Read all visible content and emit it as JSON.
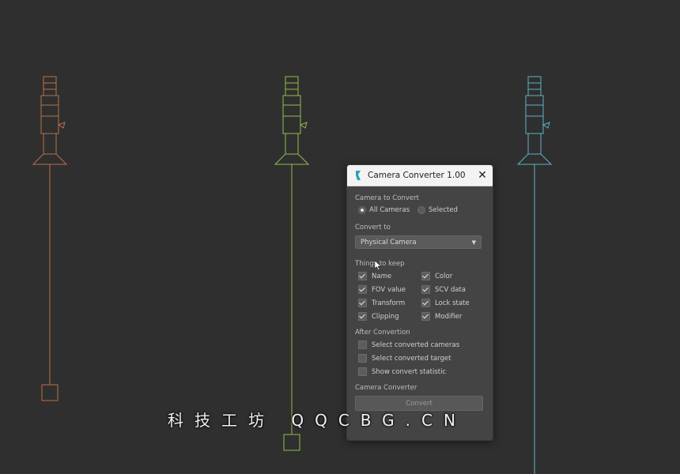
{
  "dialog": {
    "title": "Camera Converter 1.00",
    "close_glyph": "✕",
    "section_convert": "Camera to Convert",
    "radio_all": "All Cameras",
    "radio_selected": "Selected",
    "all_cameras_checked": true,
    "section_convert_to": "Convert to",
    "convert_to_value": "Physical Camera",
    "section_keep": "Things to keep",
    "keep": [
      {
        "label": "Name",
        "checked": true
      },
      {
        "label": "Color",
        "checked": true
      },
      {
        "label": "FOV value",
        "checked": true
      },
      {
        "label": "SCV data",
        "checked": true
      },
      {
        "label": "Transform",
        "checked": true
      },
      {
        "label": "Lock state",
        "checked": true
      },
      {
        "label": "Clipping",
        "checked": true
      },
      {
        "label": "Modifier",
        "checked": true
      }
    ],
    "section_after": "After Convertion",
    "after": [
      {
        "label": "Select converted cameras",
        "checked": false
      },
      {
        "label": "Select converted target",
        "checked": false
      },
      {
        "label": "Show convert statistic",
        "checked": false
      }
    ],
    "section_converter": "Camera Converter",
    "convert_button": "Convert"
  },
  "watermark": "科技工坊 QQCBG.CN",
  "colors": {
    "camera_orange": "#b8704a",
    "camera_green": "#8fbf4a",
    "camera_cyan": "#5fb2c2"
  }
}
